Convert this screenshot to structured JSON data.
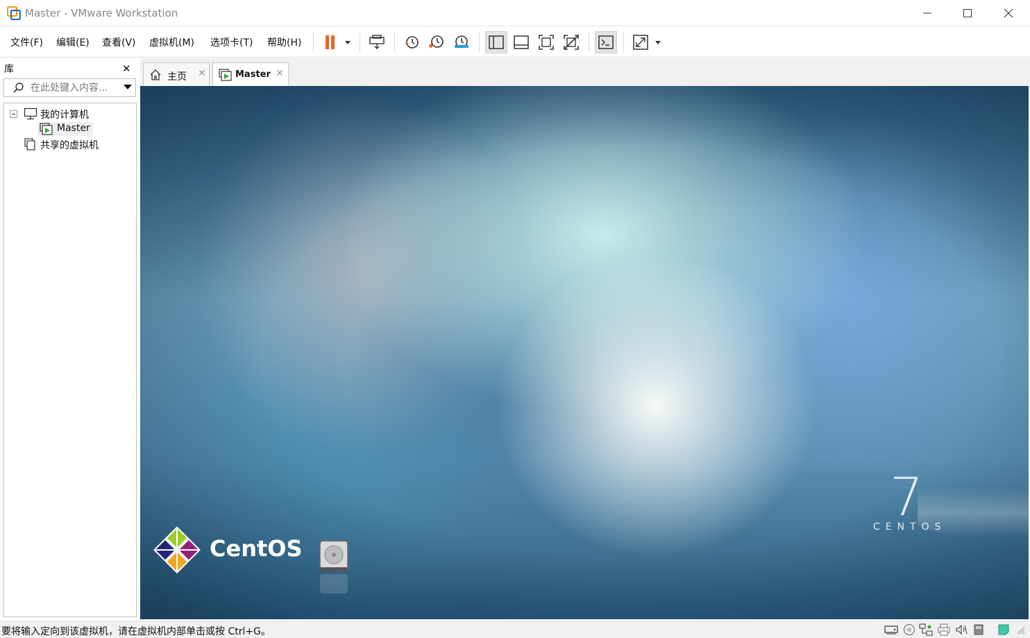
{
  "window": {
    "title": "Master - VMware Workstation"
  },
  "menu": {
    "items": [
      {
        "label": "文件(F)"
      },
      {
        "label": "编辑(E)"
      },
      {
        "label": "查看(V)"
      },
      {
        "label": "虚拟机(M)"
      },
      {
        "label": "选项卡(T)"
      },
      {
        "label": "帮助(H)"
      }
    ]
  },
  "toolbar": {
    "icons": [
      "pause-icon",
      "send-ctrl-alt-del-icon",
      "snapshot-icon",
      "revert-snapshot-icon",
      "snapshot-manager-icon",
      "show-library-icon",
      "thumbnail-bar-icon",
      "full-screen-icon",
      "unity-icon",
      "console-view-icon",
      "stretch-guest-icon"
    ],
    "accent_color": "#e8642a"
  },
  "library": {
    "title": "库",
    "search_placeholder": "在此处键入内容...",
    "tree": {
      "my_computer": "我的计算机",
      "vm_master": "Master",
      "shared_vms": "共享的虚拟机"
    }
  },
  "tabs": [
    {
      "label": "主页",
      "active": false
    },
    {
      "label": "Master",
      "active": true
    }
  ],
  "vm": {
    "brand_wordmark": "CentOS",
    "version_number": "7",
    "version_label": "CENTOS"
  },
  "statusbar": {
    "message": "要将输入定向到该虚拟机，请在虚拟机内部单击或按 Ctrl+G。",
    "device_icons": [
      "hard-disk-icon",
      "cd-dvd-icon",
      "network-icon",
      "printer-icon",
      "sound-icon",
      "usb-icon",
      "message-icon",
      "resize-grip-icon"
    ]
  }
}
